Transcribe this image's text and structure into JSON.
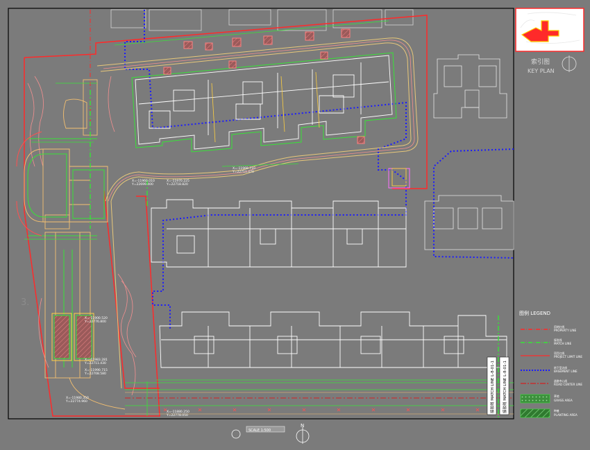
{
  "key_plan": {
    "title_cn": "索引图",
    "title_en": "KEY PLAN"
  },
  "legend": {
    "title": "图例 LEGEND",
    "items": [
      {
        "label_cn": "用地红线",
        "label_en": "PROPERTY LINE",
        "color": "#ff2a2a",
        "style": "dashdot"
      },
      {
        "label_cn": "接驳线",
        "label_en": "MATCH LINE",
        "color": "#37e337",
        "style": "dashdot"
      },
      {
        "label_cn": "项目红线",
        "label_en": "PROJECT LIMIT LINE",
        "color": "#ff2a2a",
        "style": "solid"
      },
      {
        "label_cn": "地下室边线",
        "label_en": "BASEMENT LINE",
        "color": "#1a1aff",
        "style": "dotted"
      },
      {
        "label_cn": "道路中心线",
        "label_en": "ROAD CENTER LINE",
        "color": "#d42020",
        "style": "dashdot"
      },
      {
        "label_cn": "草地",
        "label_en": "GRASS AREA",
        "color": "#3aa63a",
        "style": "hatch"
      },
      {
        "label_cn": "种植",
        "label_en": "PLANTING AREA",
        "color": "#2f8f2f",
        "style": "hatch"
      }
    ]
  },
  "match_line_note": "接驳线 MATCH LINE L-8-01-1",
  "coordinates": [
    "X=-11980.350",
    "Y=22774.960",
    "X=-11983.281",
    "Y=22711.430",
    "X=-11990.715",
    "Y=22708.580",
    "X=-11880.250",
    "Y=22778.050",
    "X=-11900.520",
    "Y=22776.800",
    "X=-11960.010",
    "Y=22699.400",
    "X=-11970.225",
    "Y=22718.820",
    "X=-11969.710",
    "Y=22711.470"
  ],
  "scale_label": "SCALE 1:500",
  "colors": {
    "background": "#7b7b7b",
    "building": "#ffffff",
    "property_line": "#ff2a2a",
    "match_line": "#37e337",
    "basement_line": "#1a1aff",
    "path": "#e8c87a"
  }
}
